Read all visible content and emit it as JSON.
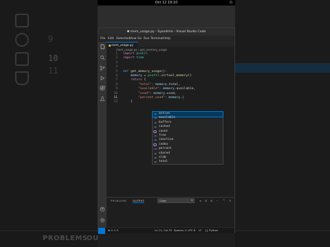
{
  "gnome": {
    "clock": "Oct 12  19:10"
  },
  "window": {
    "title": "mem_usage.py - Sysadmin - Visual Studio Code"
  },
  "menu": [
    "File",
    "Edit",
    "Selection",
    "View",
    "Go",
    "Run",
    "Terminal",
    "Help"
  ],
  "editor": {
    "tab_label": "mem_usage.py",
    "breadcrumb": "mem_usage.py › get_memory_usage"
  },
  "code_lines": [
    {
      "n": "1",
      "segments": [
        {
          "c": "kw",
          "t": "import "
        },
        {
          "c": "mod",
          "t": "psutil"
        }
      ]
    },
    {
      "n": "2",
      "segments": [
        {
          "c": "kw",
          "t": "import "
        },
        {
          "c": "mod",
          "t": "time"
        }
      ]
    },
    {
      "n": "3",
      "segments": []
    },
    {
      "n": "4",
      "segments": []
    },
    {
      "n": "5",
      "segments": [
        {
          "c": "kwb",
          "t": "def "
        },
        {
          "c": "fn",
          "t": "get_memory_usage"
        },
        {
          "c": "",
          "t": "():"
        }
      ]
    },
    {
      "n": "6",
      "segments": [
        {
          "c": "",
          "t": "    "
        },
        {
          "c": "var",
          "t": "memory"
        },
        {
          "c": "",
          "t": " = "
        },
        {
          "c": "mod",
          "t": "psutil"
        },
        {
          "c": "",
          "t": "."
        },
        {
          "c": "fn",
          "t": "virtual_memory"
        },
        {
          "c": "",
          "t": "()"
        }
      ]
    },
    {
      "n": "7",
      "segments": [
        {
          "c": "",
          "t": "    "
        },
        {
          "c": "kw",
          "t": "return "
        },
        {
          "c": "",
          "t": "{"
        }
      ]
    },
    {
      "n": "8",
      "segments": [
        {
          "c": "",
          "t": "        "
        },
        {
          "c": "str",
          "t": "\"total\""
        },
        {
          "c": "",
          "t": ": "
        },
        {
          "c": "var",
          "t": "memory"
        },
        {
          "c": "",
          "t": ".total,"
        }
      ]
    },
    {
      "n": "9",
      "segments": [
        {
          "c": "",
          "t": "        "
        },
        {
          "c": "str",
          "t": "\"available\""
        },
        {
          "c": "",
          "t": ": "
        },
        {
          "c": "var",
          "t": "memory"
        },
        {
          "c": "",
          "t": ".available,"
        }
      ]
    },
    {
      "n": "10",
      "segments": [
        {
          "c": "",
          "t": "        "
        },
        {
          "c": "str",
          "t": "\"used\""
        },
        {
          "c": "",
          "t": ": "
        },
        {
          "c": "var",
          "t": "memory"
        },
        {
          "c": "",
          "t": ".used,"
        }
      ]
    },
    {
      "n": "11",
      "segments": [
        {
          "c": "",
          "t": "        "
        },
        {
          "c": "str",
          "t": "\"percent_used\""
        },
        {
          "c": "",
          "t": ": "
        },
        {
          "c": "var",
          "t": "memory"
        },
        {
          "c": "",
          "t": ".|"
        }
      ]
    },
    {
      "n": "12",
      "segments": [
        {
          "c": "",
          "t": "    }"
        }
      ]
    }
  ],
  "suggestions": [
    {
      "kind": "ab",
      "label": "active",
      "selected": true
    },
    {
      "kind": "ab",
      "label": "available",
      "selected": false
    },
    {
      "kind": "ab",
      "label": "buffers",
      "selected": false
    },
    {
      "kind": "ab",
      "label": "cached",
      "selected": false
    },
    {
      "kind": "circle",
      "label": "count",
      "selected": false
    },
    {
      "kind": "ab",
      "label": "free",
      "selected": false
    },
    {
      "kind": "ab",
      "label": "inactive",
      "selected": false
    },
    {
      "kind": "circle",
      "label": "index",
      "selected": false
    },
    {
      "kind": "ab",
      "label": "percent",
      "selected": false
    },
    {
      "kind": "ab",
      "label": "shared",
      "selected": false
    },
    {
      "kind": "ab",
      "label": "slab",
      "selected": false
    },
    {
      "kind": "ab",
      "label": "total",
      "selected": false
    }
  ],
  "panel": {
    "tab_problems": "PROBLEMS",
    "tab_output": "OUTPUT",
    "select_value": "Code"
  },
  "status": {
    "errors": "⊗ 0 ⚠ 0",
    "position": "Ln 11, Col 33",
    "spaces": "Spaces: 4",
    "encoding": "UTF-8",
    "eol": "LF",
    "language": "{} Python",
    "interpreter": ""
  },
  "background": {
    "line_numbers": [
      "9",
      "10",
      "11"
    ],
    "bottom_problems": "PROBLEMS",
    "bottom_output": "OU"
  },
  "colors": {
    "accent": "#0078d4",
    "selection": "#04395e",
    "editor_bg": "#1e1e1e"
  }
}
